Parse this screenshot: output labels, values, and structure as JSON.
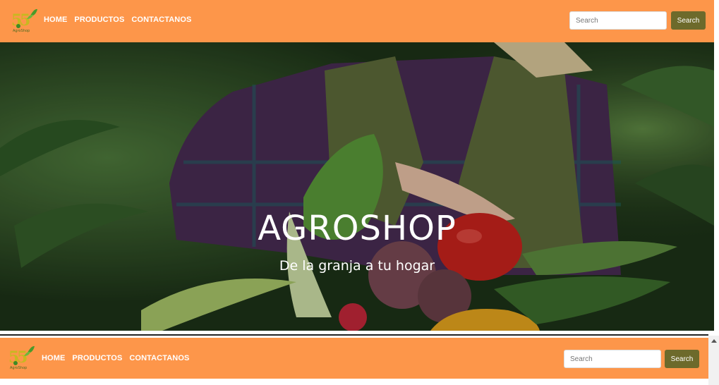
{
  "brand": {
    "logo_alt": "Agroshop logo",
    "logo_text": "AgroShop"
  },
  "nav": {
    "links": [
      {
        "label": "HOME"
      },
      {
        "label": "PRODUCTOS"
      },
      {
        "label": "CONTACTANOS"
      }
    ]
  },
  "search": {
    "placeholder": "Search",
    "button_label": "Search"
  },
  "hero": {
    "title": "AGROSHOP",
    "subtitle": "De la granja a tu hogar"
  },
  "colors": {
    "navbar": "#fd964a",
    "search_button": "#6d6a2b"
  }
}
